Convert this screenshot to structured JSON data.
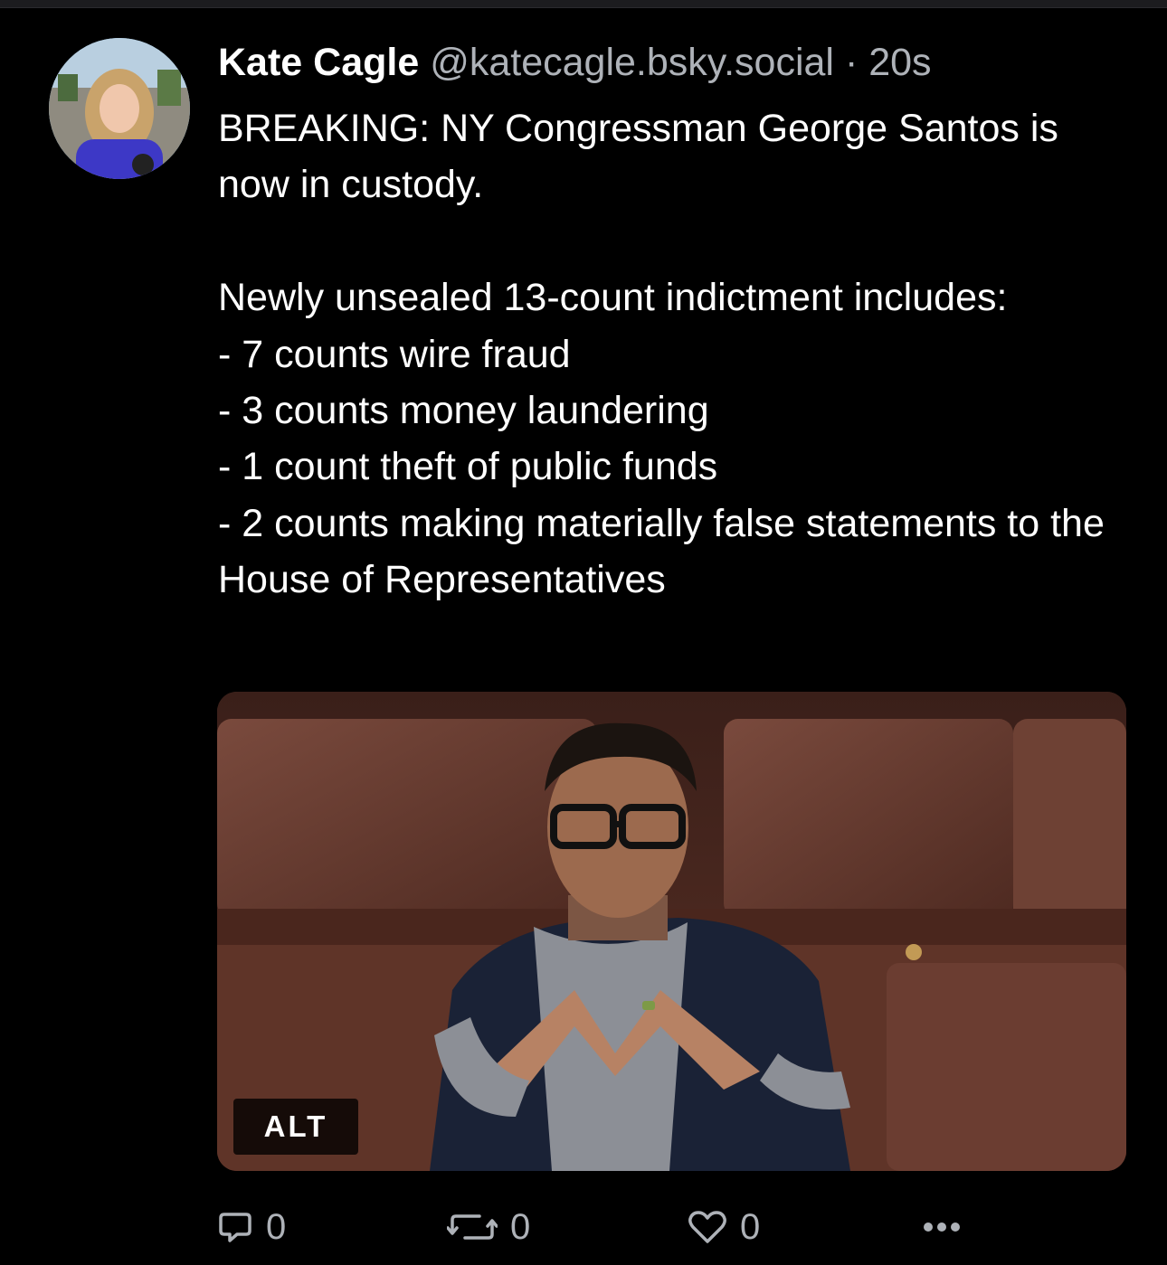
{
  "post": {
    "author": {
      "display_name": "Kate Cagle",
      "handle": "@katecagle.bsky.social",
      "avatar_icon": "avatar-photo"
    },
    "separator": "·",
    "timestamp": "20s",
    "text": "BREAKING: NY Congressman George Santos is now in custody.\n\nNewly unsealed 13-count indictment includes:\n- 7 counts wire fraud\n- 3 counts money laundering\n- 1 count theft of public funds\n- 2 counts making materially false statements to the House of Representatives",
    "media": {
      "alt_label": "ALT"
    },
    "actions": {
      "reply": {
        "icon": "speech-bubble-icon",
        "count": "0"
      },
      "repost": {
        "icon": "repost-arrows-icon",
        "count": "0"
      },
      "like": {
        "icon": "heart-outline-icon",
        "count": "0"
      },
      "more": {
        "icon": "ellipsis-icon"
      }
    }
  },
  "colors": {
    "background": "#000000",
    "text_primary": "#ffffff",
    "text_secondary": "#aeb2b8"
  }
}
